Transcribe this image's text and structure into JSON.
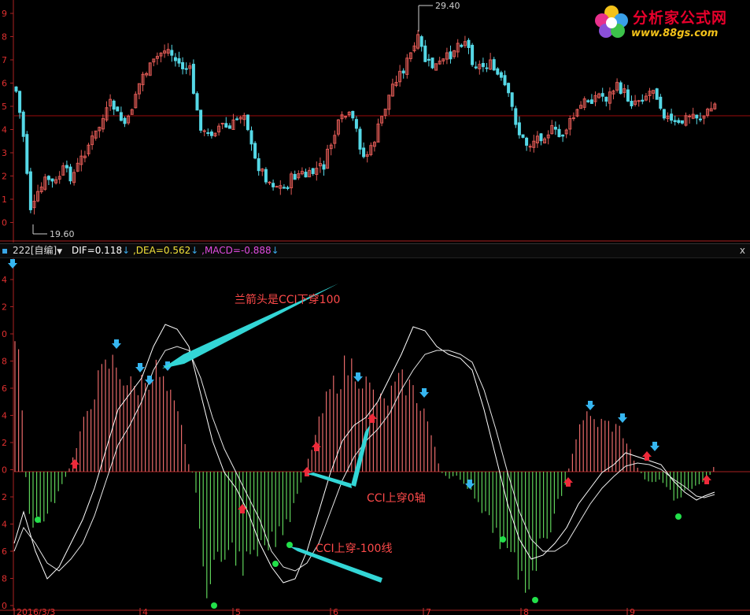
{
  "price_chart": {
    "high_label": "29.40",
    "low_label": "19.60",
    "y_ticks": [
      "9",
      "8",
      "7",
      "6",
      "5",
      "4",
      "3",
      "2",
      "1",
      "0"
    ],
    "up_color": "#e05a55",
    "down_color": "#55d8e6",
    "ref_line_color": "#9b0d0d"
  },
  "indicator_bar": {
    "name": "222[自编]",
    "dif": "DIF=0.118",
    "dea": ",DEA=0.562",
    "macd": ",MACD=-0.888",
    "dif_color": "#ffffff",
    "dea_color": "#f2e23a",
    "macd_color": "#e04be0",
    "close_symbol": "x"
  },
  "annotations": {
    "blue_arrow_note": "兰箭头是CCI下穿100",
    "cross_zero_note": "CCI上穿0轴",
    "cross_minus100_note": "CCI上穿-100线"
  },
  "lower_y_ticks": [
    "4",
    "2",
    "0",
    "8",
    "6",
    "4",
    "2",
    "0",
    "2",
    "4",
    "6",
    "8",
    "0"
  ],
  "x_axis": {
    "labels": [
      "2016/3/3",
      "4",
      "5",
      "6",
      "7",
      "8",
      "9"
    ]
  },
  "logo": {
    "title": "分析家公式网",
    "url": "www.88gs.com"
  },
  "chart_data": [
    {
      "type": "candlestick",
      "title": "",
      "annotations": [
        "29.40",
        "19.60"
      ],
      "ylabel": "",
      "note": "price candles, red = up, cyan = down"
    },
    {
      "type": "bar",
      "title": "",
      "annotations": [
        "兰箭头是CCI下穿100",
        "CCI上穿0轴",
        "CCI上穿-100线"
      ],
      "series": [
        {
          "name": "DIF",
          "values": [
            0.118
          ]
        },
        {
          "name": "DEA",
          "values": [
            0.562
          ]
        },
        {
          "name": "MACD",
          "values": [
            -0.888
          ]
        }
      ]
    }
  ]
}
